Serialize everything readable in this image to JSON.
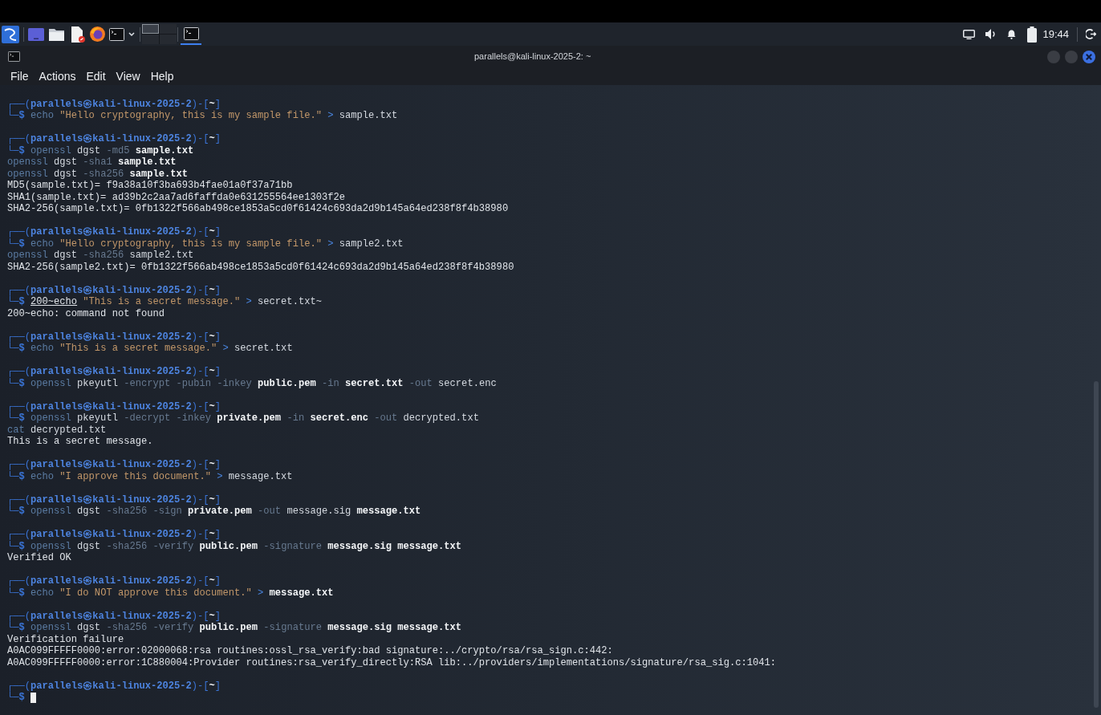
{
  "taskbar": {
    "workspaces": [
      {
        "selected": true
      },
      {
        "selected": false
      },
      {
        "selected": false
      },
      {
        "selected": false
      }
    ],
    "tasks": [
      {
        "selected": true
      }
    ],
    "clock": "19:44"
  },
  "window": {
    "title": "parallels@kali-linux-2025-2: ~"
  },
  "menu": [
    "File",
    "Actions",
    "Edit",
    "View",
    "Help"
  ],
  "terminal": {
    "blocks": [
      {
        "prompt": [
          {
            "text": "┌──(",
            "kind": "frame"
          },
          {
            "text": "parallels㉿kali-linux-2025-2",
            "kind": "host"
          },
          {
            "text": ")-[",
            "kind": "frame"
          },
          {
            "text": "~",
            "kind": "dir"
          },
          {
            "text": "]",
            "kind": "frame"
          }
        ],
        "command": [
          {
            "text": "└─",
            "kind": "frame"
          },
          {
            "text": "$ ",
            "kind": "sigil"
          },
          {
            "text": "echo ",
            "kind": "cmd"
          },
          {
            "text": "\"Hello cryptography, this is my sample file.\" ",
            "kind": "string"
          },
          {
            "text": "> ",
            "kind": "operator"
          },
          {
            "text": "sample.txt",
            "kind": "arg"
          }
        ],
        "cursor": false
      },
      {
        "prompt": [
          {
            "text": "┌──(",
            "kind": "frame"
          },
          {
            "text": "parallels㉿kali-linux-2025-2",
            "kind": "host"
          },
          {
            "text": ")-[",
            "kind": "frame"
          },
          {
            "text": "~",
            "kind": "dir"
          },
          {
            "text": "]",
            "kind": "frame"
          }
        ],
        "command": [
          {
            "text": "└─",
            "kind": "frame"
          },
          {
            "text": "$ ",
            "kind": "sigil"
          },
          {
            "text": "openssl ",
            "kind": "cmd"
          },
          {
            "text": "dgst ",
            "kind": "arg"
          },
          {
            "text": "-md5 ",
            "kind": "option"
          },
          {
            "text": "sample.txt",
            "kind": "file"
          }
        ],
        "cursor": false,
        "output": [
          [
            {
              "text": "openssl ",
              "kind": "cmd"
            },
            {
              "text": "dgst ",
              "kind": "arg"
            },
            {
              "text": "-sha1 ",
              "kind": "option"
            },
            {
              "text": "sample.txt",
              "kind": "file"
            }
          ],
          [
            {
              "text": "openssl ",
              "kind": "cmd"
            },
            {
              "text": "dgst ",
              "kind": "arg"
            },
            {
              "text": "-sha256 ",
              "kind": "option"
            },
            {
              "text": "sample.txt",
              "kind": "file"
            }
          ],
          [
            {
              "text": "MD5(sample.txt)= f9a38a10f3ba693b4fae01a0f37a71bb",
              "kind": "plain"
            }
          ],
          [
            {
              "text": "SHA1(sample.txt)= ad39b2c2aa7ad6faffda0e631255564ee1303f2e",
              "kind": "plain"
            }
          ],
          [
            {
              "text": "SHA2-256(sample.txt)= 0fb1322f566ab498ce1853a5cd0f61424c693da2d9b145a64ed238f8f4b38980",
              "kind": "plain"
            }
          ]
        ]
      },
      {
        "prompt": [
          {
            "text": "┌──(",
            "kind": "frame"
          },
          {
            "text": "parallels㉿kali-linux-2025-2",
            "kind": "host"
          },
          {
            "text": ")-[",
            "kind": "frame"
          },
          {
            "text": "~",
            "kind": "dir"
          },
          {
            "text": "]",
            "kind": "frame"
          }
        ],
        "command": [
          {
            "text": "└─",
            "kind": "frame"
          },
          {
            "text": "$ ",
            "kind": "sigil"
          },
          {
            "text": "echo ",
            "kind": "cmd"
          },
          {
            "text": "\"Hello cryptography, this is my sample file.\" ",
            "kind": "string"
          },
          {
            "text": "> ",
            "kind": "operator"
          },
          {
            "text": "sample2.txt",
            "kind": "arg"
          }
        ],
        "cursor": false,
        "output": [
          [
            {
              "text": "openssl ",
              "kind": "cmd"
            },
            {
              "text": "dgst ",
              "kind": "arg"
            },
            {
              "text": "-sha256 ",
              "kind": "option"
            },
            {
              "text": "sample2.txt",
              "kind": "arg"
            }
          ],
          [
            {
              "text": "SHA2-256(sample2.txt)= 0fb1322f566ab498ce1853a5cd0f61424c693da2d9b145a64ed238f8f4b38980",
              "kind": "plain"
            }
          ]
        ]
      },
      {
        "prompt": [
          {
            "text": "┌──(",
            "kind": "frame"
          },
          {
            "text": "parallels㉿kali-linux-2025-2",
            "kind": "host"
          },
          {
            "text": ")-[",
            "kind": "frame"
          },
          {
            "text": "~",
            "kind": "dir"
          },
          {
            "text": "]",
            "kind": "frame"
          }
        ],
        "command": [
          {
            "text": "└─",
            "kind": "frame"
          },
          {
            "text": "$ ",
            "kind": "sigil"
          },
          {
            "text": "200~echo",
            "kind": "underline"
          },
          {
            "text": " \"This is a secret message.\"",
            "kind": "string"
          },
          {
            "text": " >",
            "kind": "operator"
          },
          {
            "text": " secret.txt~",
            "kind": "arg"
          }
        ],
        "cursor": false,
        "output": [
          [
            {
              "text": "200~echo: command not found",
              "kind": "plain"
            }
          ]
        ]
      },
      {
        "prompt": [
          {
            "text": "┌──(",
            "kind": "frame"
          },
          {
            "text": "parallels㉿kali-linux-2025-2",
            "kind": "host"
          },
          {
            "text": ")-[",
            "kind": "frame"
          },
          {
            "text": "~",
            "kind": "dir"
          },
          {
            "text": "]",
            "kind": "frame"
          }
        ],
        "command": [
          {
            "text": "└─",
            "kind": "frame"
          },
          {
            "text": "$ ",
            "kind": "sigil"
          },
          {
            "text": "echo ",
            "kind": "cmd"
          },
          {
            "text": "\"This is a secret message.\" ",
            "kind": "string"
          },
          {
            "text": "> ",
            "kind": "operator"
          },
          {
            "text": "secret.txt",
            "kind": "arg"
          }
        ],
        "cursor": false
      },
      {
        "prompt": [
          {
            "text": "┌──(",
            "kind": "frame"
          },
          {
            "text": "parallels㉿kali-linux-2025-2",
            "kind": "host"
          },
          {
            "text": ")-[",
            "kind": "frame"
          },
          {
            "text": "~",
            "kind": "dir"
          },
          {
            "text": "]",
            "kind": "frame"
          }
        ],
        "command": [
          {
            "text": "└─",
            "kind": "frame"
          },
          {
            "text": "$ ",
            "kind": "sigil"
          },
          {
            "text": "openssl ",
            "kind": "cmd"
          },
          {
            "text": "pkeyutl ",
            "kind": "arg"
          },
          {
            "text": "-encrypt -pubin -inkey ",
            "kind": "option"
          },
          {
            "text": "public.pem ",
            "kind": "file"
          },
          {
            "text": "-in ",
            "kind": "option"
          },
          {
            "text": "secret.txt ",
            "kind": "file"
          },
          {
            "text": "-out ",
            "kind": "option"
          },
          {
            "text": "secret.enc",
            "kind": "arg"
          }
        ],
        "cursor": false
      },
      {
        "prompt": [
          {
            "text": "┌──(",
            "kind": "frame"
          },
          {
            "text": "parallels㉿kali-linux-2025-2",
            "kind": "host"
          },
          {
            "text": ")-[",
            "kind": "frame"
          },
          {
            "text": "~",
            "kind": "dir"
          },
          {
            "text": "]",
            "kind": "frame"
          }
        ],
        "command": [
          {
            "text": "└─",
            "kind": "frame"
          },
          {
            "text": "$ ",
            "kind": "sigil"
          },
          {
            "text": "openssl ",
            "kind": "cmd"
          },
          {
            "text": "pkeyutl ",
            "kind": "arg"
          },
          {
            "text": "-decrypt -inkey ",
            "kind": "option"
          },
          {
            "text": "private.pem ",
            "kind": "file"
          },
          {
            "text": "-in ",
            "kind": "option"
          },
          {
            "text": "secret.enc ",
            "kind": "file"
          },
          {
            "text": "-out ",
            "kind": "option"
          },
          {
            "text": "decrypted.txt",
            "kind": "arg"
          }
        ],
        "cursor": false,
        "output": [
          [
            {
              "text": "cat ",
              "kind": "cmd"
            },
            {
              "text": "decrypted.txt",
              "kind": "arg"
            }
          ],
          [
            {
              "text": "This is a secret message.",
              "kind": "plain"
            }
          ]
        ]
      },
      {
        "prompt": [
          {
            "text": "┌──(",
            "kind": "frame"
          },
          {
            "text": "parallels㉿kali-linux-2025-2",
            "kind": "host"
          },
          {
            "text": ")-[",
            "kind": "frame"
          },
          {
            "text": "~",
            "kind": "dir"
          },
          {
            "text": "]",
            "kind": "frame"
          }
        ],
        "command": [
          {
            "text": "└─",
            "kind": "frame"
          },
          {
            "text": "$ ",
            "kind": "sigil"
          },
          {
            "text": "echo ",
            "kind": "cmd"
          },
          {
            "text": "\"I approve this document.\" ",
            "kind": "string"
          },
          {
            "text": "> ",
            "kind": "operator"
          },
          {
            "text": "message.txt",
            "kind": "arg"
          }
        ],
        "cursor": false
      },
      {
        "prompt": [
          {
            "text": "┌──(",
            "kind": "frame"
          },
          {
            "text": "parallels㉿kali-linux-2025-2",
            "kind": "host"
          },
          {
            "text": ")-[",
            "kind": "frame"
          },
          {
            "text": "~",
            "kind": "dir"
          },
          {
            "text": "]",
            "kind": "frame"
          }
        ],
        "command": [
          {
            "text": "└─",
            "kind": "frame"
          },
          {
            "text": "$ ",
            "kind": "sigil"
          },
          {
            "text": "openssl ",
            "kind": "cmd"
          },
          {
            "text": "dgst ",
            "kind": "arg"
          },
          {
            "text": "-sha256 -sign ",
            "kind": "option"
          },
          {
            "text": "private.pem ",
            "kind": "file"
          },
          {
            "text": "-out ",
            "kind": "option"
          },
          {
            "text": "message.sig ",
            "kind": "arg"
          },
          {
            "text": "message.txt",
            "kind": "file"
          }
        ],
        "cursor": false
      },
      {
        "prompt": [
          {
            "text": "┌──(",
            "kind": "frame"
          },
          {
            "text": "parallels㉿kali-linux-2025-2",
            "kind": "host"
          },
          {
            "text": ")-[",
            "kind": "frame"
          },
          {
            "text": "~",
            "kind": "dir"
          },
          {
            "text": "]",
            "kind": "frame"
          }
        ],
        "command": [
          {
            "text": "└─",
            "kind": "frame"
          },
          {
            "text": "$ ",
            "kind": "sigil"
          },
          {
            "text": "openssl ",
            "kind": "cmd"
          },
          {
            "text": "dgst ",
            "kind": "arg"
          },
          {
            "text": "-sha256 -verify ",
            "kind": "option"
          },
          {
            "text": "public.pem ",
            "kind": "file"
          },
          {
            "text": "-signature ",
            "kind": "option"
          },
          {
            "text": "message.sig message.txt",
            "kind": "file"
          }
        ],
        "cursor": false,
        "output": [
          [
            {
              "text": "Verified OK",
              "kind": "plain"
            }
          ]
        ]
      },
      {
        "prompt": [
          {
            "text": "┌──(",
            "kind": "frame"
          },
          {
            "text": "parallels㉿kali-linux-2025-2",
            "kind": "host"
          },
          {
            "text": ")-[",
            "kind": "frame"
          },
          {
            "text": "~",
            "kind": "dir"
          },
          {
            "text": "]",
            "kind": "frame"
          }
        ],
        "command": [
          {
            "text": "└─",
            "kind": "frame"
          },
          {
            "text": "$ ",
            "kind": "sigil"
          },
          {
            "text": "echo ",
            "kind": "cmd"
          },
          {
            "text": "\"I do NOT approve this document.\" ",
            "kind": "string"
          },
          {
            "text": "> ",
            "kind": "operator"
          },
          {
            "text": "message.txt",
            "kind": "file"
          }
        ],
        "cursor": false
      },
      {
        "prompt": [
          {
            "text": "┌──(",
            "kind": "frame"
          },
          {
            "text": "parallels㉿kali-linux-2025-2",
            "kind": "host"
          },
          {
            "text": ")-[",
            "kind": "frame"
          },
          {
            "text": "~",
            "kind": "dir"
          },
          {
            "text": "]",
            "kind": "frame"
          }
        ],
        "command": [
          {
            "text": "└─",
            "kind": "frame"
          },
          {
            "text": "$ ",
            "kind": "sigil"
          },
          {
            "text": "openssl ",
            "kind": "cmd"
          },
          {
            "text": "dgst ",
            "kind": "arg"
          },
          {
            "text": "-sha256 -verify ",
            "kind": "option"
          },
          {
            "text": "public.pem ",
            "kind": "file"
          },
          {
            "text": "-signature ",
            "kind": "option"
          },
          {
            "text": "message.sig message.txt",
            "kind": "file"
          }
        ],
        "cursor": false,
        "output": [
          [
            {
              "text": "Verification failure",
              "kind": "plain"
            }
          ],
          [
            {
              "text": "A0AC099FFFFF0000:error:02000068:rsa routines:ossl_rsa_verify:bad signature:../crypto/rsa/rsa_sign.c:442:",
              "kind": "plain"
            }
          ],
          [
            {
              "text": "A0AC099FFFFF0000:error:1C880004:Provider routines:rsa_verify_directly:RSA lib:../providers/implementations/signature/rsa_sig.c:1041:",
              "kind": "plain"
            }
          ]
        ]
      },
      {
        "prompt": [
          {
            "text": "┌──(",
            "kind": "frame"
          },
          {
            "text": "parallels㉿kali-linux-2025-2",
            "kind": "host"
          },
          {
            "text": ")-[",
            "kind": "frame"
          },
          {
            "text": "~",
            "kind": "dir"
          },
          {
            "text": "]",
            "kind": "frame"
          }
        ],
        "command": [
          {
            "text": "└─",
            "kind": "frame"
          },
          {
            "text": "$",
            "kind": "sigil"
          }
        ],
        "cursor": true
      }
    ]
  }
}
